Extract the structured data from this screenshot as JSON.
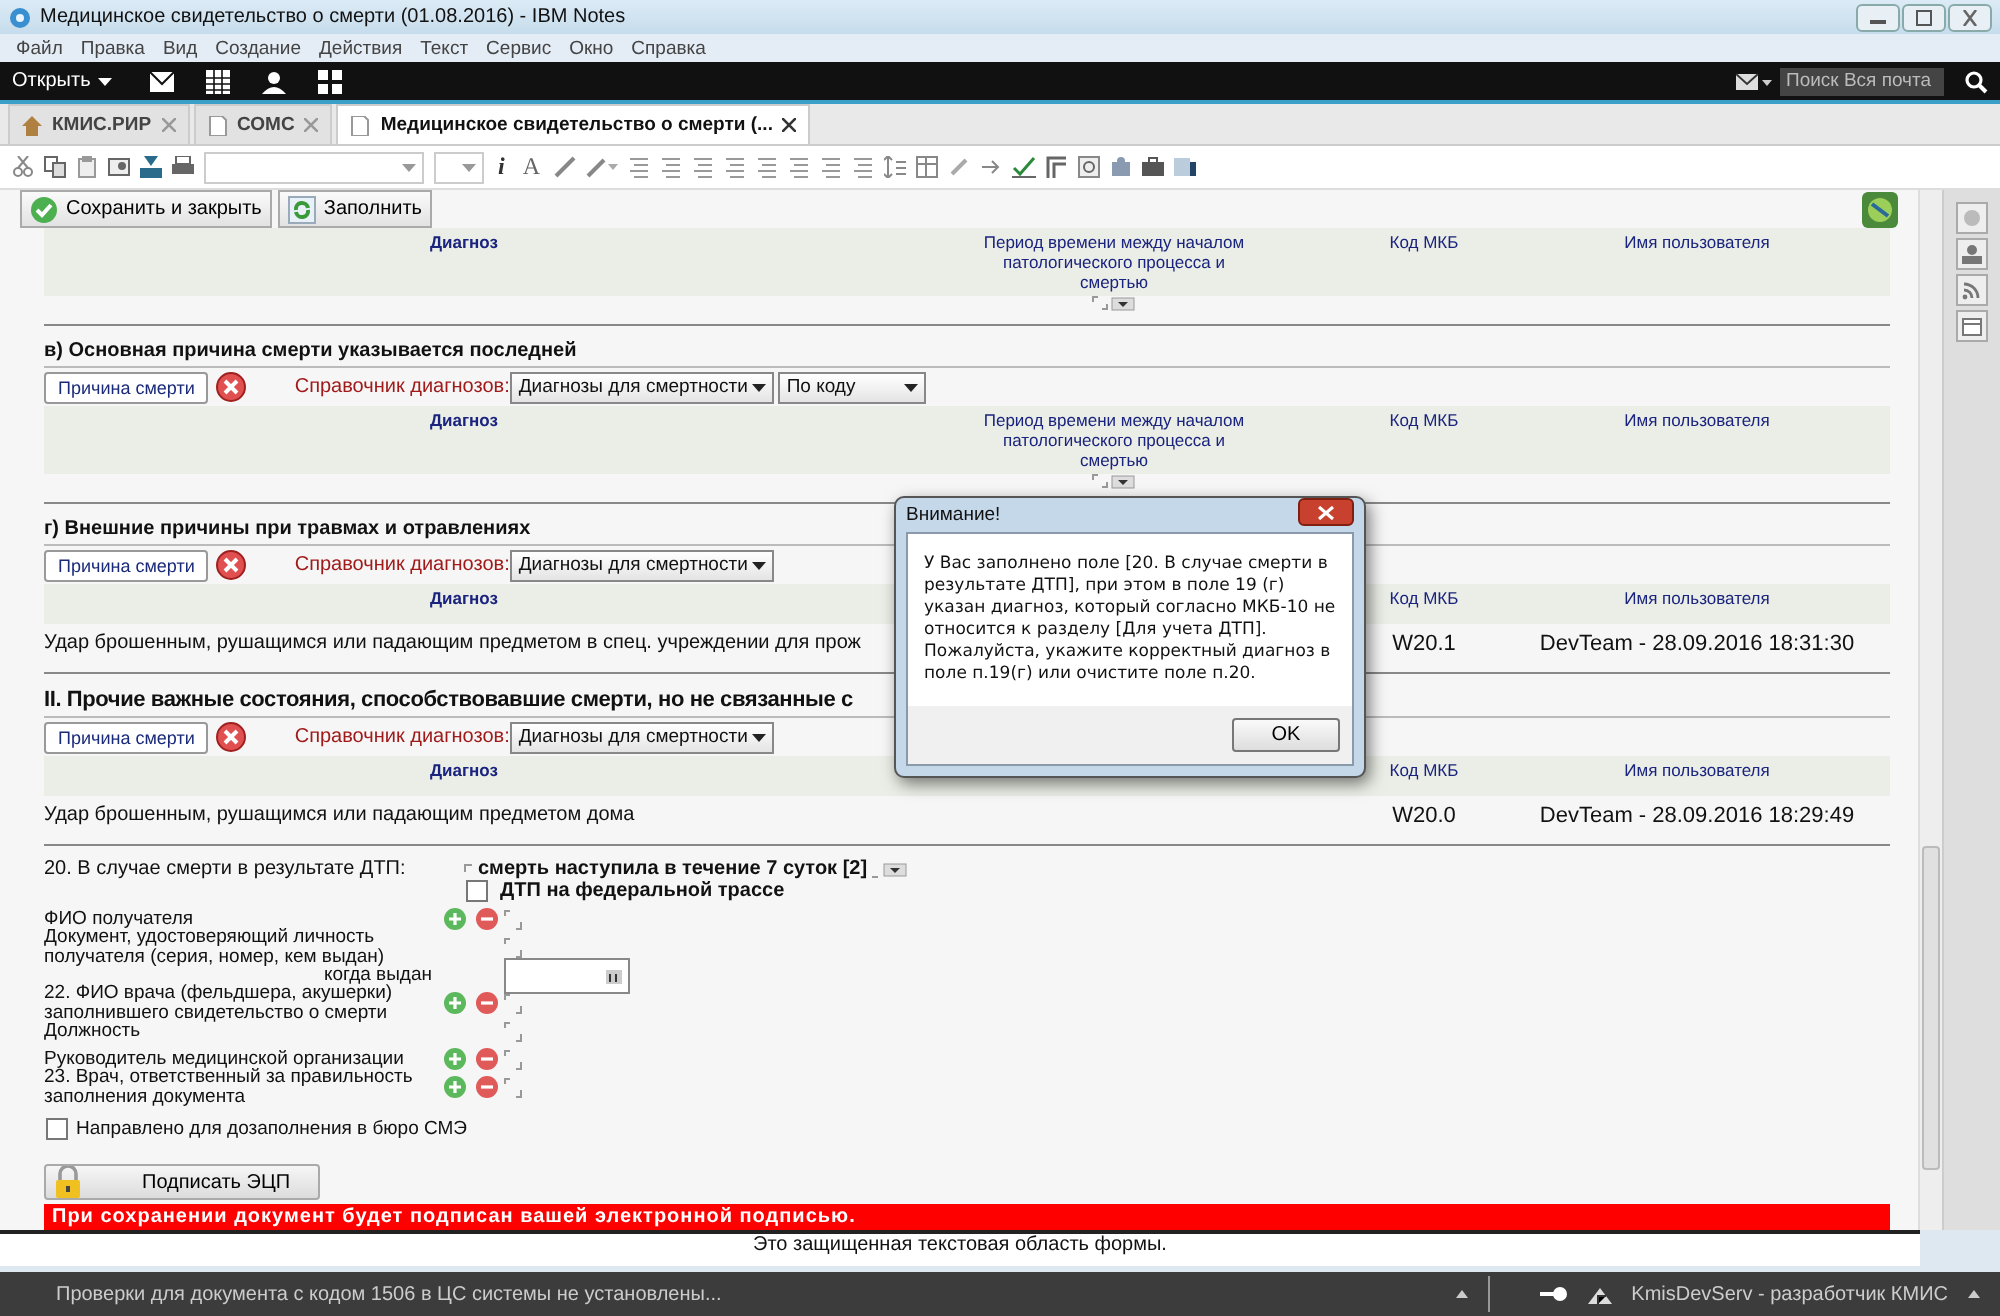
{
  "window": {
    "title": "Медицинское свидетельство о смерти  (01.08.2016) - IBM Notes"
  },
  "menu": [
    "Файл",
    "Правка",
    "Вид",
    "Создание",
    "Действия",
    "Текст",
    "Сервис",
    "Окно",
    "Справка"
  ],
  "launcher": {
    "open_label": "Открыть",
    "search_placeholder": "Поиск Вся почта"
  },
  "tabs": [
    {
      "label": "КМИС.РИР",
      "selected": false
    },
    {
      "label": "СОМС",
      "selected": false
    },
    {
      "label": "Медицинское свидетельство о смерти  (...",
      "selected": true
    }
  ],
  "format_toolbar": {
    "text_buttons": [
      "i",
      "A"
    ]
  },
  "actions": [
    {
      "label": "Сохранить и закрыть"
    },
    {
      "label": "Заполнить"
    }
  ],
  "sections": [
    {
      "header": {
        "diagnosis": "Диагноз",
        "period": "Период времени между началом патологического процесса и смертью",
        "code": "Код МКБ",
        "user": "Имя пользователя"
      }
    },
    {
      "heading": "в) Основная причина смерти указывается последней",
      "major": false,
      "cause_button": "Причина смерти",
      "directory_label": "Справочник диагнозов:",
      "dropdowns": [
        "Диагнозы для смертности",
        "По коду"
      ],
      "header": {
        "diagnosis": "Диагноз",
        "period": "Период времени между началом патологического процесса и смертью",
        "code": "Код МКБ",
        "user": "Имя пользователя"
      }
    },
    {
      "heading": "г) Внешние причины при травмах и отравлениях",
      "major": false,
      "cause_button": "Причина смерти",
      "directory_label": "Справочник диагнозов:",
      "dropdowns": [
        "Диагнозы для смертности"
      ],
      "header": {
        "diagnosis": "Диагноз",
        "code": "Код МКБ",
        "user": "Имя пользователя"
      },
      "rows": [
        {
          "diagnosis": "Удар брошенным, рушащимся или падающим предметом в спец. учреждении для прож",
          "code": "W20.1",
          "user": "DevTeam - 28.09.2016 18:31:30"
        }
      ]
    },
    {
      "heading": "II. Прочие важные состояния, способствовавшие смерти, но не связанные с",
      "major": true,
      "cause_button": "Причина смерти",
      "directory_label": "Справочник диагнозов:",
      "dropdowns": [
        "Диагнозы для смертности"
      ],
      "header": {
        "diagnosis": "Диагноз",
        "code": "Код МКБ",
        "user": "Имя пользователя"
      },
      "rows": [
        {
          "diagnosis": "Удар брошенным, рушащимся или падающим предметом дома",
          "code": "W20.0",
          "user": "DevTeam - 28.09.2016 18:29:49"
        }
      ]
    }
  ],
  "accident": {
    "label": "20. В случае смерти в результате ДТП:",
    "value": "смерть наступила в течение 7 суток [2]",
    "federal": {
      "label": "ДТП на федеральной трассе",
      "checked": false
    }
  },
  "fields": [
    {
      "kind": "person",
      "label": "ФИО получателя"
    },
    {
      "kind": "text",
      "label": "Документ, удостоверяющий личность получателя (серия, номер, кем выдан)"
    },
    {
      "kind": "date",
      "label": "когда выдан"
    },
    {
      "kind": "person",
      "label": "22. ФИО врача (фельдшера, акушерки) заполнившего  свидетельство о смерти"
    },
    {
      "kind": "text",
      "label": "Должность"
    },
    {
      "kind": "person",
      "label": "Руководитель медицинской организации"
    },
    {
      "kind": "person",
      "label": "23. Врач, ответственный за правильность заполнения документа"
    }
  ],
  "referral": {
    "label": "Направлено для дозаполнения в бюро СМЭ",
    "checked": false
  },
  "sign": {
    "label": "Подписать ЭЦП",
    "banner": "При сохранении документ будет подписан вашей электронной подписью."
  },
  "footer_note": "Это защищенная текстовая область формы.",
  "status": {
    "message": "Проверки для документа с кодом  1506 в ЦС системы не установлены...",
    "server": "KmisDevServ - разработчик КМИС"
  },
  "dialog": {
    "title": "Внимание!",
    "message": "У Вас заполнено поле [20. В случае смерти в результате ДТП], при этом в поле 19 (г) указан диагноз, который согласно МКБ-10 не относится к разделу [Для учета ДТП]. Пожалуйста, укажите корректный диагноз в поле п.19(г) или очистите поле п.20.",
    "ok": "OK"
  }
}
